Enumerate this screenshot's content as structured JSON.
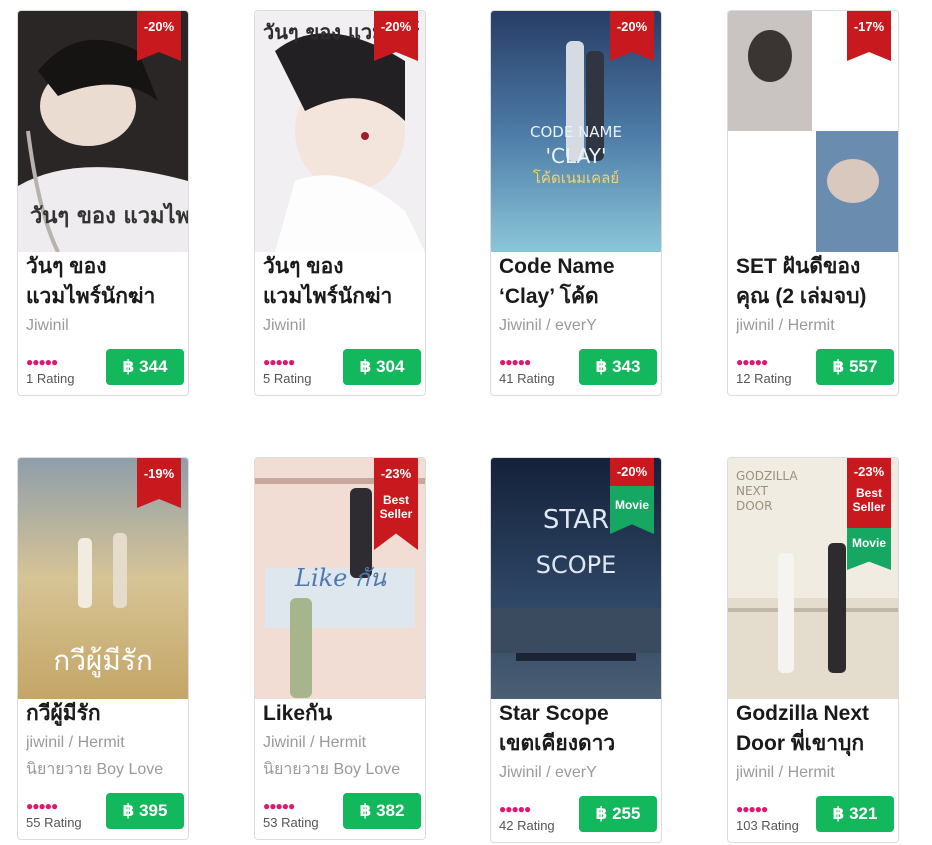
{
  "books": [
    {
      "title_lines": [
        "วันๆ ของ",
        "แวมไพร์นักฆ่า"
      ],
      "meta_lines": [
        "Jiwinil"
      ],
      "discount": "-20%",
      "stars": "●●●●●",
      "rating": "1 Rating",
      "price": "฿ 344",
      "cover_color": "#2b2b2b"
    },
    {
      "title_lines": [
        "วันๆ ของ",
        "แวมไพร์นักฆ่า"
      ],
      "meta_lines": [
        "Jiwinil"
      ],
      "discount": "-20%",
      "stars": "●●●●●",
      "rating": "5 Rating",
      "price": "฿ 304",
      "cover_color": "#e8e4ea"
    },
    {
      "title_lines": [
        "Code Name",
        "‘Clay’ โค้ด"
      ],
      "meta_lines": [
        "Jiwinil / everY"
      ],
      "discount": "-20%",
      "stars": "●●●●●",
      "rating": "41 Rating",
      "price": "฿ 343",
      "cover_color": "#3f6f94"
    },
    {
      "title_lines": [
        "SET ฝันดีของ",
        "คุณ (2 เล่มจบ)"
      ],
      "meta_lines": [
        "jiwinil / Hermit"
      ],
      "discount": "-17%",
      "stars": "●●●●●",
      "rating": "12 Rating",
      "price": "฿ 557",
      "cover_color": "#ffffff"
    },
    {
      "title_lines": [
        "กวีผู้มีรัก"
      ],
      "meta_lines": [
        "jiwinil / Hermit",
        "นิยายวาย Boy Love"
      ],
      "discount": "-19%",
      "stars": "●●●●●",
      "rating": "55 Rating",
      "price": "฿ 395",
      "cover_color": "#c9b98a"
    },
    {
      "title_lines": [
        "Likeกัน"
      ],
      "meta_lines": [
        "Jiwinil / Hermit",
        "นิยายวาย Boy Love"
      ],
      "discount": "-23%",
      "discount_sub": "Best Seller",
      "stars": "●●●●●",
      "rating": "53 Rating",
      "price": "฿ 382",
      "cover_color": "#f1dcd2"
    },
    {
      "title_lines": [
        "Star Scope",
        "เขตเคียงดาว"
      ],
      "meta_lines": [
        "Jiwinil / everY"
      ],
      "discount": "-20%",
      "movie": "Movie",
      "stars": "●●●●●",
      "rating": "42 Rating",
      "price": "฿ 255",
      "cover_color": "#1d2c45"
    },
    {
      "title_lines": [
        "Godzilla Next",
        "Door พี่เขาบุก"
      ],
      "meta_lines": [
        "jiwinil / Hermit"
      ],
      "discount": "-23%",
      "discount_sub": "Best Seller",
      "movie": "Movie",
      "stars": "●●●●●",
      "rating": "103 Rating",
      "price": "฿ 321",
      "cover_color": "#efe9dc"
    }
  ],
  "cover_texts": {
    "b0": "วันๆ ของ แวมไพร์",
    "b1": "วันๆ ของ แวมไพร์",
    "b2_a": "CODE NAME",
    "b2_b": "'CLAY'",
    "b2_c": "โค้ดเนมเคลย์",
    "b4": "กวีผู้มีรัก",
    "b5": "Like กัน",
    "b6_a": "STAR",
    "b6_b": "SCOPE",
    "b7_a": "GODZILLA",
    "b7_b": "NEXT",
    "b7_c": "DOOR"
  }
}
